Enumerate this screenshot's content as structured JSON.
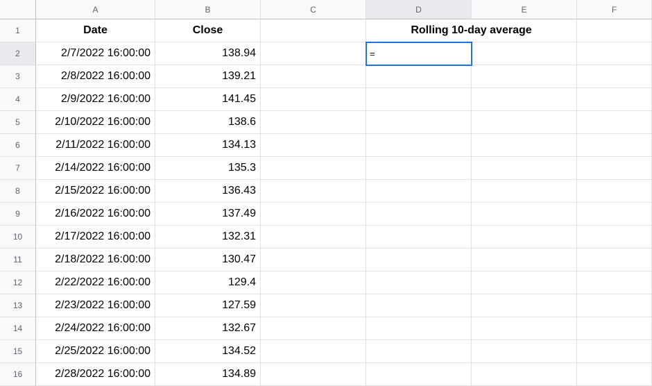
{
  "columns": [
    "A",
    "B",
    "C",
    "D",
    "E",
    "F"
  ],
  "activeColumn": "D",
  "activeRow": "2",
  "headers": {
    "A": "Date",
    "B": "Close",
    "D_merged": "Rolling 10-day average"
  },
  "activeCellValue": "=",
  "rows": [
    {
      "n": "1"
    },
    {
      "n": "2",
      "date": "2/7/2022 16:00:00",
      "close": "138.94"
    },
    {
      "n": "3",
      "date": "2/8/2022 16:00:00",
      "close": "139.21"
    },
    {
      "n": "4",
      "date": "2/9/2022 16:00:00",
      "close": "141.45"
    },
    {
      "n": "5",
      "date": "2/10/2022 16:00:00",
      "close": "138.6"
    },
    {
      "n": "6",
      "date": "2/11/2022 16:00:00",
      "close": "134.13"
    },
    {
      "n": "7",
      "date": "2/14/2022 16:00:00",
      "close": "135.3"
    },
    {
      "n": "8",
      "date": "2/15/2022 16:00:00",
      "close": "136.43"
    },
    {
      "n": "9",
      "date": "2/16/2022 16:00:00",
      "close": "137.49"
    },
    {
      "n": "10",
      "date": "2/17/2022 16:00:00",
      "close": "132.31"
    },
    {
      "n": "11",
      "date": "2/18/2022 16:00:00",
      "close": "130.47"
    },
    {
      "n": "12",
      "date": "2/22/2022 16:00:00",
      "close": "129.4"
    },
    {
      "n": "13",
      "date": "2/23/2022 16:00:00",
      "close": "127.59"
    },
    {
      "n": "14",
      "date": "2/24/2022 16:00:00",
      "close": "132.67"
    },
    {
      "n": "15",
      "date": "2/25/2022 16:00:00",
      "close": "134.52"
    },
    {
      "n": "16",
      "date": "2/28/2022 16:00:00",
      "close": "134.89"
    }
  ]
}
